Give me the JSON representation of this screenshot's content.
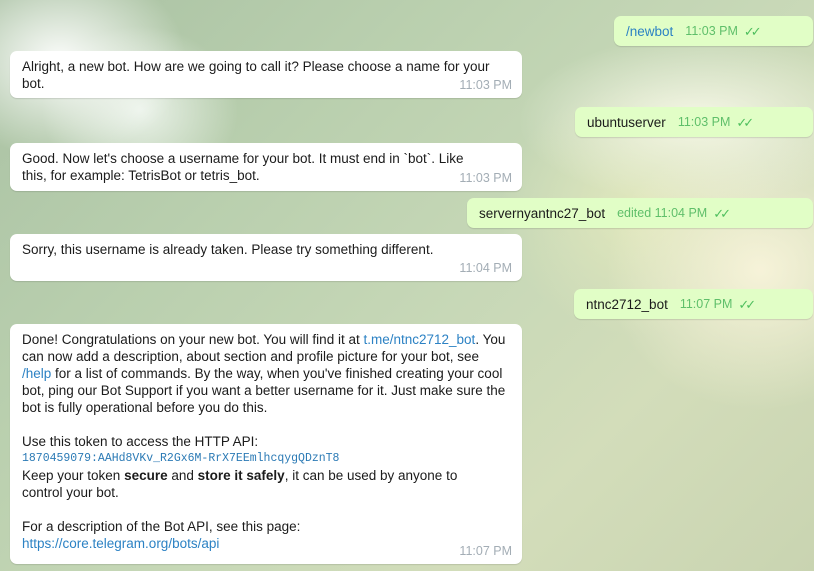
{
  "messages": {
    "m1": {
      "text": "/newbot",
      "time": "11:03 PM"
    },
    "m2": {
      "text": "Alright, a new bot. How are we going to call it? Please choose a name for your bot.",
      "time": "11:03 PM"
    },
    "m3": {
      "text": "ubuntuserver",
      "time": "11:03 PM"
    },
    "m4": {
      "text": "Good. Now let's choose a username for your bot. It must end in `bot`. Like this, for example: TetrisBot or tetris_bot.",
      "time": "11:03 PM"
    },
    "m5": {
      "text": "servernyantnc27_bot",
      "time": "edited 11:04 PM"
    },
    "m6": {
      "text": "Sorry, this username is already taken. Please try something different.",
      "time": "11:04 PM"
    },
    "m7": {
      "text": "ntnc2712_bot",
      "time": "11:07 PM"
    },
    "m8": {
      "p1_a": "Done! Congratulations on your new bot. You will find it at ",
      "p1_link": "t.me/ntnc2712_bot",
      "p1_b": ". You can now add a description, about section and profile picture for your bot, see ",
      "p1_cmd": "/help",
      "p1_c": " for a list of commands. By the way, when you've finished creating your cool bot, ping our Bot Support if you want a better username for it. Just make sure the bot is fully operational before you do this.",
      "p2_a": "Use this token to access the HTTP API:",
      "token": "1870459079:AAHd8VKv_R2Gx6M-RrX7EEmlhcqygQDznT8",
      "p2_b": "Keep your token ",
      "p2_secure": "secure",
      "p2_c": " and ",
      "p2_store": "store it safely",
      "p2_d": ", it can be used by anyone to control your bot.",
      "p3_a": "For a description of the Bot API, see this page:",
      "p3_link": "https://core.telegram.org/bots/api",
      "time": "11:07 PM"
    }
  },
  "read_receipt_icon": "double-check-icon",
  "colors": {
    "outgoing_bubble": "#e1fec6",
    "incoming_bubble": "#ffffff",
    "link": "#2c82c4",
    "check": "#4fbf5e"
  }
}
